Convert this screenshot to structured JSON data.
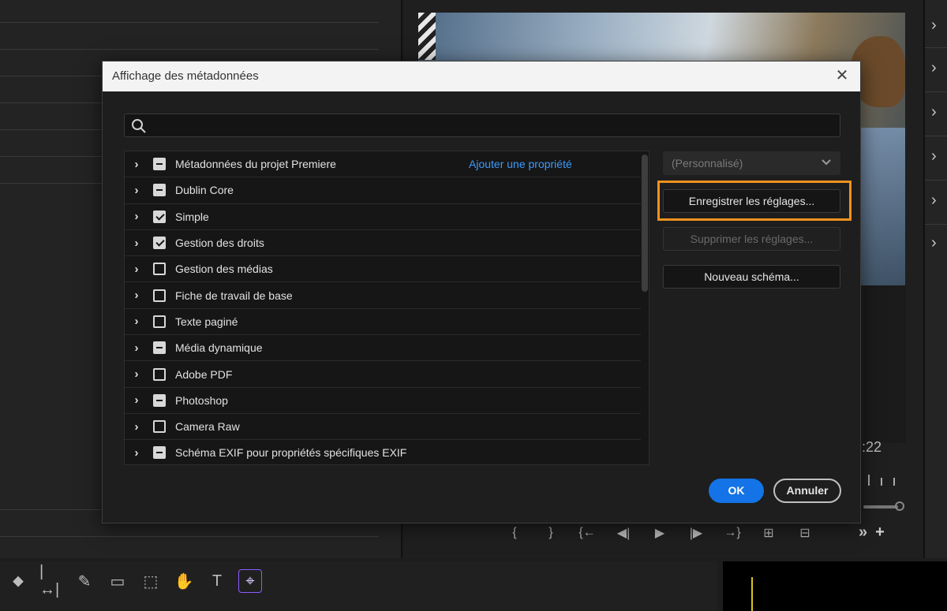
{
  "dialog": {
    "title": "Affichage des métadonnées",
    "search": {
      "value": "",
      "placeholder": ""
    },
    "add_property_link": "Ajouter une propriété",
    "schemas": [
      {
        "label": "Métadonnées du projet Premiere",
        "state": "mixed"
      },
      {
        "label": "Dublin Core",
        "state": "mixed"
      },
      {
        "label": "Simple",
        "state": "checked"
      },
      {
        "label": "Gestion des droits",
        "state": "checked"
      },
      {
        "label": "Gestion des médias",
        "state": "unchecked"
      },
      {
        "label": "Fiche de travail de base",
        "state": "unchecked"
      },
      {
        "label": "Texte paginé",
        "state": "unchecked"
      },
      {
        "label": "Média dynamique",
        "state": "mixed"
      },
      {
        "label": "Adobe PDF",
        "state": "unchecked"
      },
      {
        "label": "Photoshop",
        "state": "mixed"
      },
      {
        "label": "Camera Raw",
        "state": "unchecked"
      },
      {
        "label": "Schéma EXIF pour propriétés spécifiques EXIF",
        "state": "mixed"
      }
    ],
    "preset_dropdown": {
      "value": "(Personnalisé)"
    },
    "buttons": {
      "save_settings": "Enregistrer les réglages...",
      "delete_settings": "Supprimer les réglages...",
      "new_schema": "Nouveau schéma...",
      "ok": "OK",
      "cancel": "Annuler"
    }
  },
  "background": {
    "timecode_fragment": ":22"
  },
  "colors": {
    "accent": "#1473e6",
    "link": "#3b9cff",
    "highlight": "#f0921e"
  }
}
